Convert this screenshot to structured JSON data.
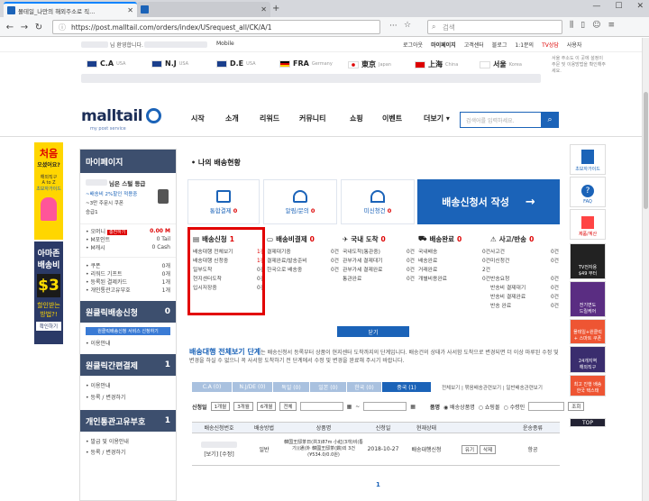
{
  "browser": {
    "tab1_title": "몰테일_나만의 해외주소로 직...",
    "tab2_title": "",
    "url": "https://post.malltail.com/orders/index/USrequest_all/CK/A/1",
    "search_placeholder": "검색"
  },
  "util": {
    "left_text": "님 환영합니다.",
    "mobile": "Mobile",
    "login": "로그아웃",
    "mypage": "마이페이지",
    "cs": "고객센터",
    "blog": "블로그",
    "shop": "1:1문의",
    "tv": "TV상담",
    "lang": "사용자"
  },
  "flags": [
    {
      "code": "C.A",
      "sub": "USA",
      "color": "#1b3f8c"
    },
    {
      "code": "N.J",
      "sub": "USA",
      "color": "#1b3f8c"
    },
    {
      "code": "D.E",
      "sub": "USA",
      "color": "#1b3f8c"
    },
    {
      "code": "FRA",
      "sub": "Germany",
      "color": "#000000"
    },
    {
      "code": "東京",
      "sub": "Japan",
      "color": "#d00000"
    },
    {
      "code": "上海",
      "sub": "China",
      "color": "#d00000"
    },
    {
      "code": "서울",
      "sub": "Korea",
      "color": "#1b3f8c"
    }
  ],
  "flags_note": "서울 주소도 이 곳에 설정이 주문 및 이용방법을 확인해주세요.",
  "nav": {
    "logo": "malltail",
    "logo_sub": "my post service",
    "items": [
      "시작",
      "소개",
      "리워드",
      "커뮤니티",
      "쇼핑",
      "이벤트",
      "더보기 ▾"
    ],
    "search_placeholder": "검색어를 입력하세요."
  },
  "banner": {
    "top_line1": "처음",
    "top_line2": "오셨어요?",
    "top_line3": "해외직구",
    "top_line4": "A to Z",
    "top_line5": "초보자가이드",
    "mid_line1": "아마존",
    "mid_line2": "배송비",
    "mid_amount": "$3",
    "mid_line3": "할인받는",
    "mid_line4": "방법?!",
    "mid_btn": "확인하기"
  },
  "sidebar": {
    "mypage": "마이페이지",
    "grade": "님은 스털 등급",
    "promo1": "~배송비 2%할인 적용중",
    "promo2": "~3만 주문시 쿠폰",
    "promo3": "승급1",
    "rows": [
      {
        "label": "• 오머니",
        "badge": "충전하기",
        "value": "0.00 M"
      },
      {
        "label": "• M포인트",
        "value": "0 Tail"
      },
      {
        "label": "• M캐시",
        "value": "0 Cash"
      },
      {
        "label": "• 쿠폰",
        "value": "0개"
      },
      {
        "label": "• 리워드 기프트",
        "value": "0개"
      },
      {
        "label": "• 등록된 결제카드",
        "value": "1개"
      },
      {
        "label": "• 개인통관고유부호",
        "value": "1개"
      }
    ],
    "sec1": "원클릭배송신청",
    "sec1_n": "0",
    "sec1_badge": "원클릭배송신청 서비스 신청하기",
    "sec1_item": "• 이용안내",
    "sec2": "원클릭간편결제",
    "sec2_n": "1",
    "sec2_items": [
      "• 이용안내",
      "• 등록 / 변경하기"
    ],
    "sec3": "개인통관고유부호",
    "sec3_n": "1",
    "sec3_items": [
      "• 발급 및 이용안내",
      "• 등록 / 변경하기"
    ]
  },
  "content": {
    "section_title": "나의 배송현황",
    "stats": [
      {
        "label": "통합결제",
        "n": "0"
      },
      {
        "label": "알림/문의",
        "n": "0"
      },
      {
        "label": "미신청건",
        "n": "0"
      }
    ],
    "big_btn": "배송신청서 작성",
    "columns": [
      {
        "title": "배송신청",
        "n": "1",
        "rows": [
          [
            "배송대행 전체보기",
            "1건"
          ],
          [
            "배송대행 신청중",
            "1건"
          ],
          [
            "일부도착",
            "0건"
          ],
          [
            "현지센터도착",
            "0건"
          ],
          [
            "입시저장중",
            "0건"
          ]
        ]
      },
      {
        "title": "배송비결제",
        "n": "0",
        "rows": [
          [
            "결제대기중",
            "0건"
          ],
          [
            "결제완료/발송준비",
            "0건"
          ],
          [
            "한국으로 배송중",
            "0건"
          ]
        ]
      },
      {
        "title": "국내 도착",
        "n": "0",
        "rows": [
          [
            "국내도착(통관중)",
            "0건"
          ],
          [
            "관부가세 결제대기",
            "0건"
          ],
          [
            "관부가세 결제완료",
            "0건"
          ],
          [
            "통관완료",
            "0건"
          ]
        ]
      },
      {
        "title": "배송완료",
        "n": "0",
        "rows": [
          [
            "국내배송",
            "0건"
          ],
          [
            "배송완료",
            "0건"
          ],
          [
            "거래완료",
            "2건"
          ],
          [
            "개별비용완료",
            "0건"
          ]
        ]
      },
      {
        "title": "사고/반송",
        "n": "0",
        "rows": [
          [
            "사고건",
            "0건"
          ],
          [
            "미신청건",
            "0건"
          ],
          [
            "",
            "",
            ""
          ],
          [
            "반송요청",
            "0건"
          ],
          [
            "반송비 결제대기",
            "0건"
          ],
          [
            "반송비 결제완료",
            "0건"
          ],
          [
            "반송 완료",
            "0건"
          ]
        ]
      }
    ],
    "dangi": "닫기",
    "all_title": "배송대행 전체보기 단계",
    "all_desc": "는 배송신청서 등록부터 상품이 현지센터 도착까지의 단계입니다. 배송건의 상태가 사서함 도착으로 변경되면 더 이상 마루된 수정 및 변경을 하실 수 없으니 꼭 사서함 도착하기 전 단계에서 수정 및 변경을 완료해 주시기 바랍니다.",
    "tabs": [
      "C.A (0)",
      "N.J/DE (0)",
      "독일 (0)",
      "일본 (0)",
      "한국 (0)",
      "중국 (1)"
    ],
    "tab_links": "전체보기 | 묶음배송관련보기 | 일반배송관련보기",
    "filter_label": "신청일",
    "filter_btns": [
      "1개월",
      "3개월",
      "6개월",
      "전체"
    ],
    "filter_item": "품명",
    "radios": [
      "배송상품명",
      "쇼핑몰",
      "수령인"
    ],
    "filter_search": "조회",
    "table_head": [
      "배송신청번호",
      "배송방법",
      "상품명",
      "신청일",
      "현재상태",
      "",
      "운송종류"
    ],
    "row": {
      "no": "[보기] [수정]",
      "method": "일반",
      "goods": "韓国王邸茶日(共3)87m 小紅(3개)비(통기)(通)外 韓國王邸茶(鷄)외 3건 (¥534.0/0.0원)",
      "date": "2018-10-27",
      "status": "배송대행신청",
      "btn1": "유기",
      "btn2": "삭제",
      "type": "항공"
    },
    "page": "1"
  },
  "rail": {
    "items": [
      "초보자가이드",
      "FAQ",
      "제품/계산",
      "TV전자용\n$49 부터",
      "전기면도\n드릴케어",
      "몰테일+원클릭\n+ 스마트 쿠폰",
      "24개지역\n해외직구",
      "최고 진행 배송\n한국 택스태"
    ],
    "top": "TOP"
  }
}
